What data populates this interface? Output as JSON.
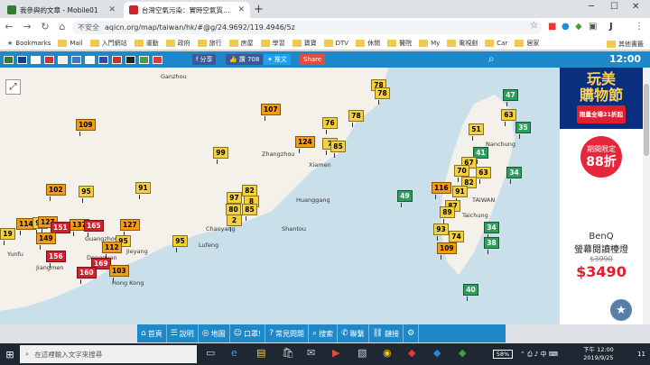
{
  "browser": {
    "tabs": [
      {
        "title": "我參與的文章 - Mobile01",
        "favicon_color": "#2e7d32",
        "active": false
      },
      {
        "title": "台灣空氣污染：實時空氣質量指數地",
        "favicon_color": "#c62828",
        "active": true
      }
    ],
    "url_security": "不安全",
    "url": "aqicn.org/map/taiwan/hk/#@g/24.9692/119.4946/5z",
    "profile_badge": "J",
    "bookmarks": [
      {
        "label": "Bookmarks",
        "folder": false
      },
      {
        "label": "Mail",
        "folder": true
      },
      {
        "label": "入門網站",
        "folder": true
      },
      {
        "label": "運動",
        "folder": true
      },
      {
        "label": "政府",
        "folder": true
      },
      {
        "label": "旅行",
        "folder": true
      },
      {
        "label": "房屋",
        "folder": true
      },
      {
        "label": "學習",
        "folder": true
      },
      {
        "label": "寶寶",
        "folder": true
      },
      {
        "label": "DTV",
        "folder": true
      },
      {
        "label": "休閒",
        "folder": true
      },
      {
        "label": "醫院",
        "folder": true
      },
      {
        "label": "My",
        "folder": true
      },
      {
        "label": "電視劇",
        "folder": true
      },
      {
        "label": "Car",
        "folder": true
      },
      {
        "label": "居家",
        "folder": true
      },
      {
        "label": "其他書籤",
        "folder": true
      }
    ]
  },
  "mapbar": {
    "share_label": "分享",
    "like_label": "讚 708",
    "tweet_label": "推文",
    "share2_label": "Share",
    "time": "12:00"
  },
  "map": {
    "labels": [
      "Ganzhou",
      "Zhangzhou",
      "Xiamen",
      "Huanggang",
      "Shantou",
      "Chaoyang",
      "Lufeng",
      "Jieyang",
      "Jiangmen",
      "Hong Kong",
      "Yunfu",
      "Dongguan",
      "Guangzhou",
      "Taichung",
      "TAIWAN",
      "Nanchung"
    ],
    "stations": [
      {
        "v": "78",
        "c": "#f4d03f"
      },
      {
        "v": "78",
        "c": "#f4d03f"
      },
      {
        "v": "109",
        "c": "#f39c12"
      },
      {
        "v": "107",
        "c": "#f39c12"
      },
      {
        "v": "76",
        "c": "#f4d03f"
      },
      {
        "v": "78",
        "c": "#f4d03f"
      },
      {
        "v": "124",
        "c": "#f39c12"
      },
      {
        "v": "7",
        "c": "#f4d03f"
      },
      {
        "v": "85",
        "c": "#f4d03f"
      },
      {
        "v": "99",
        "c": "#f4d03f"
      },
      {
        "v": "91",
        "c": "#f4d03f"
      },
      {
        "v": "102",
        "c": "#f39c12"
      },
      {
        "v": "95",
        "c": "#f4d03f"
      },
      {
        "v": "97",
        "c": "#f4d03f"
      },
      {
        "v": "82",
        "c": "#f4d03f"
      },
      {
        "v": "8",
        "c": "#f4d03f"
      },
      {
        "v": "80",
        "c": "#f4d03f"
      },
      {
        "v": "85",
        "c": "#f4d03f"
      },
      {
        "v": "2",
        "c": "#f4d03f"
      },
      {
        "v": "114",
        "c": "#f39c12"
      },
      {
        "v": "92",
        "c": "#f4d03f"
      },
      {
        "v": "127",
        "c": "#f39c12"
      },
      {
        "v": "137",
        "c": "#f39c12"
      },
      {
        "v": "165",
        "c": "#d91e2b"
      },
      {
        "v": "127",
        "c": "#f39c12"
      },
      {
        "v": "151",
        "c": "#d91e2b"
      },
      {
        "v": "149",
        "c": "#f39c12"
      },
      {
        "v": "95",
        "c": "#f4d03f"
      },
      {
        "v": "112",
        "c": "#f39c12"
      },
      {
        "v": "156",
        "c": "#d91e2b"
      },
      {
        "v": "169",
        "c": "#d91e2b"
      },
      {
        "v": "160",
        "c": "#d91e2b"
      },
      {
        "v": "103",
        "c": "#f39c12"
      },
      {
        "v": "95",
        "c": "#f4d03f"
      },
      {
        "v": "49",
        "c": "#2e9e5b"
      },
      {
        "v": "47",
        "c": "#2e9e5b"
      },
      {
        "v": "63",
        "c": "#f4d03f"
      },
      {
        "v": "35",
        "c": "#2e9e5b"
      },
      {
        "v": "51",
        "c": "#f4d03f"
      },
      {
        "v": "41",
        "c": "#2e9e5b"
      },
      {
        "v": "67",
        "c": "#f4d03f"
      },
      {
        "v": "70",
        "c": "#f4d03f"
      },
      {
        "v": "63",
        "c": "#f4d03f"
      },
      {
        "v": "34",
        "c": "#2e9e5b"
      },
      {
        "v": "82",
        "c": "#f4d03f"
      },
      {
        "v": "116",
        "c": "#f39c12"
      },
      {
        "v": "91",
        "c": "#f4d03f"
      },
      {
        "v": "87",
        "c": "#f4d03f"
      },
      {
        "v": "89",
        "c": "#f4d03f"
      },
      {
        "v": "93",
        "c": "#f4d03f"
      },
      {
        "v": "74",
        "c": "#f4d03f"
      },
      {
        "v": "34",
        "c": "#2e9e5b"
      },
      {
        "v": "38",
        "c": "#2e9e5b"
      },
      {
        "v": "109",
        "c": "#f39c12"
      },
      {
        "v": "40",
        "c": "#2e9e5b"
      },
      {
        "v": "19",
        "c": "#f4d03f"
      }
    ]
  },
  "ad": {
    "title1": "玩美",
    "title2": "購物節",
    "subtitle": "限量全場21折起",
    "badge_line1": "期間限定",
    "badge_line2": "88折",
    "brand": "BenQ",
    "product": "螢幕閱讀檯燈",
    "was_price": "$3990",
    "price": "$3490"
  },
  "bottom_nav": [
    {
      "icon": "⌂",
      "label": "首頁"
    },
    {
      "icon": "☰",
      "label": "說明"
    },
    {
      "icon": "◎",
      "label": "地圖"
    },
    {
      "icon": "☺",
      "label": "口罩!"
    },
    {
      "icon": "?",
      "label": "常見問題"
    },
    {
      "icon": "⌕",
      "label": "搜索"
    },
    {
      "icon": "✆",
      "label": "聯繫"
    },
    {
      "icon": "⛓",
      "label": "鏈接"
    },
    {
      "icon": "⚙",
      "label": ""
    }
  ],
  "taskbar": {
    "search_placeholder": "在這裡輸入文字來搜尋",
    "battery": "58%",
    "time": "下午 12:00",
    "date": "2019/9/25",
    "notifications": "11"
  }
}
